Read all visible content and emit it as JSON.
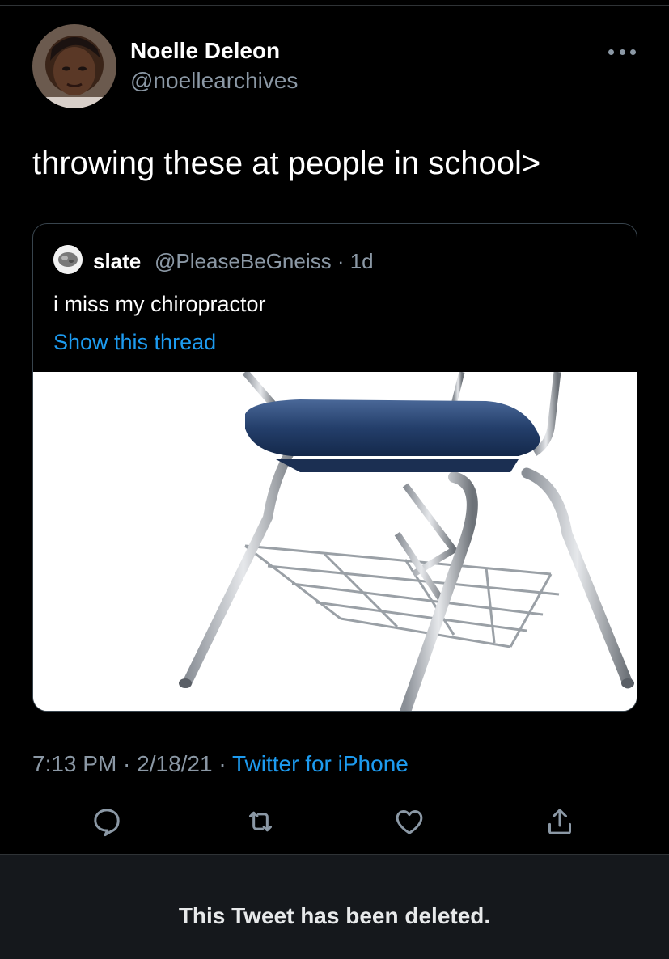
{
  "tweet": {
    "author_name": "Noelle Deleon",
    "author_handle": "@noellearchives",
    "text": "throwing these at people in school>",
    "timestamp": "7:13 PM · 2/18/21 · ",
    "source": "Twitter for iPhone"
  },
  "quoted_tweet": {
    "author_name": "slate",
    "meta": "@PleaseBeGneiss · 1d",
    "text": "i miss my chiropractor",
    "show_thread_label": "Show this thread"
  },
  "icons": {
    "more": "more-horizontal-icon",
    "reply": "reply-icon",
    "retweet": "retweet-icon",
    "like": "heart-icon",
    "share": "share-icon"
  },
  "colors": {
    "background": "#000000",
    "link": "#1d9bf0",
    "secondary_text": "#8b98a5",
    "border": "#38444d",
    "deleted_bar": "#15181c",
    "chair_seat": "#1f3a63"
  },
  "footer": {
    "deleted_notice": "This Tweet has been deleted."
  }
}
